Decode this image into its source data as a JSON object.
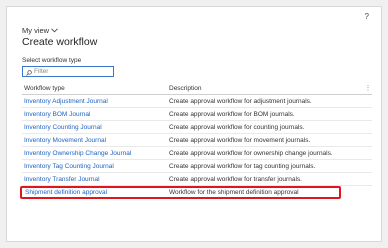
{
  "help_label": "?",
  "view": {
    "label": "My view"
  },
  "title": "Create workflow",
  "select_label": "Select workflow type",
  "filter": {
    "placeholder": "Filter",
    "value": ""
  },
  "grid": {
    "columns": [
      "Workflow type",
      "Description"
    ],
    "rows": [
      {
        "type": "Inventory Adjustment Journal",
        "description": "Create approval workflow for adjustment journals."
      },
      {
        "type": "Inventory BOM Journal",
        "description": "Create approval workflow for BOM journals."
      },
      {
        "type": "Inventory Counting Journal",
        "description": "Create approval workflow for counting journals."
      },
      {
        "type": "Inventory Movement Journal",
        "description": "Create approval workflow for movement journals."
      },
      {
        "type": "Inventory Ownership Change Journal",
        "description": "Create approval workflow for ownership change journals."
      },
      {
        "type": "Inventory Tag Counting Journal",
        "description": "Create approval workflow for tag counting journals."
      },
      {
        "type": "Inventory Transfer Journal",
        "description": "Create approval workflow for transfer journals."
      },
      {
        "type": "Shipment definition approval",
        "description": "Workflow for the shipment definition approval",
        "highlighted": true
      }
    ]
  },
  "colors": {
    "link": "#1e63c4",
    "highlight_border": "#e0161c",
    "filter_border": "#3b76c8"
  },
  "icons": [
    "chevron-down-icon",
    "search-icon",
    "column-options-icon"
  ]
}
